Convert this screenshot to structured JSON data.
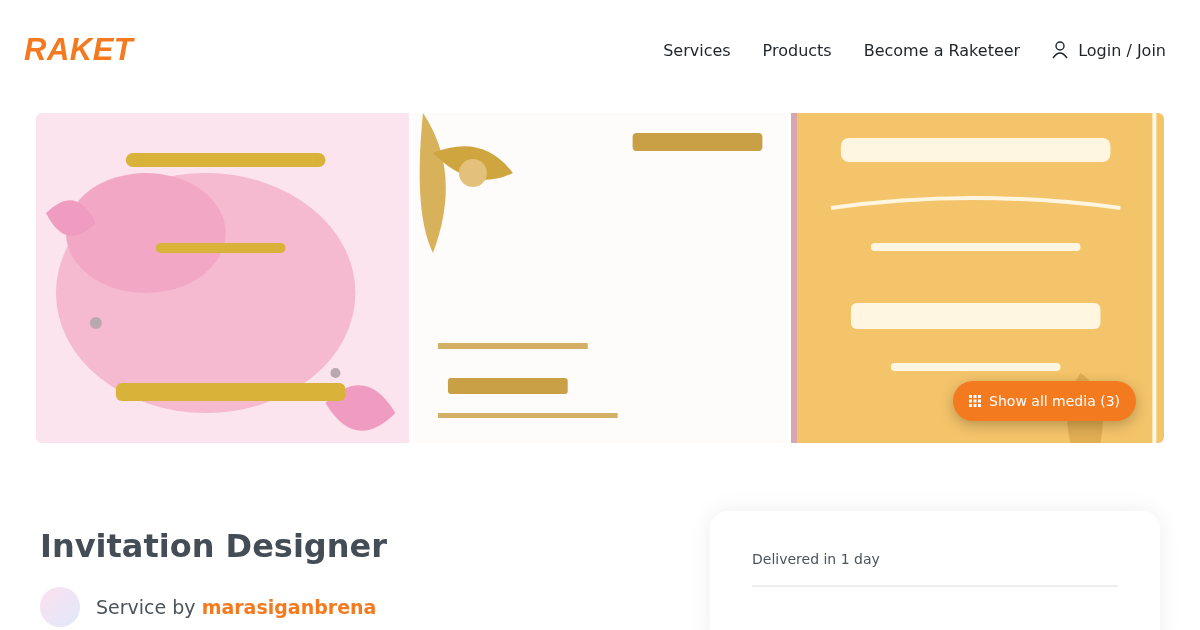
{
  "header": {
    "logo": "RAKET",
    "nav": [
      {
        "label": "Services",
        "kind": "link"
      },
      {
        "label": "Products",
        "kind": "link"
      },
      {
        "label": "Become a Raketeer",
        "kind": "link"
      },
      {
        "label": "Login / Join",
        "kind": "account"
      }
    ]
  },
  "gallery": {
    "show_all_button": "Show all media (3)"
  },
  "service": {
    "title": "Invitation Designer",
    "by_label": "Service by",
    "seller": "marasiganbrena"
  },
  "order_card": {
    "delivery": "Delivered in 1 day"
  }
}
